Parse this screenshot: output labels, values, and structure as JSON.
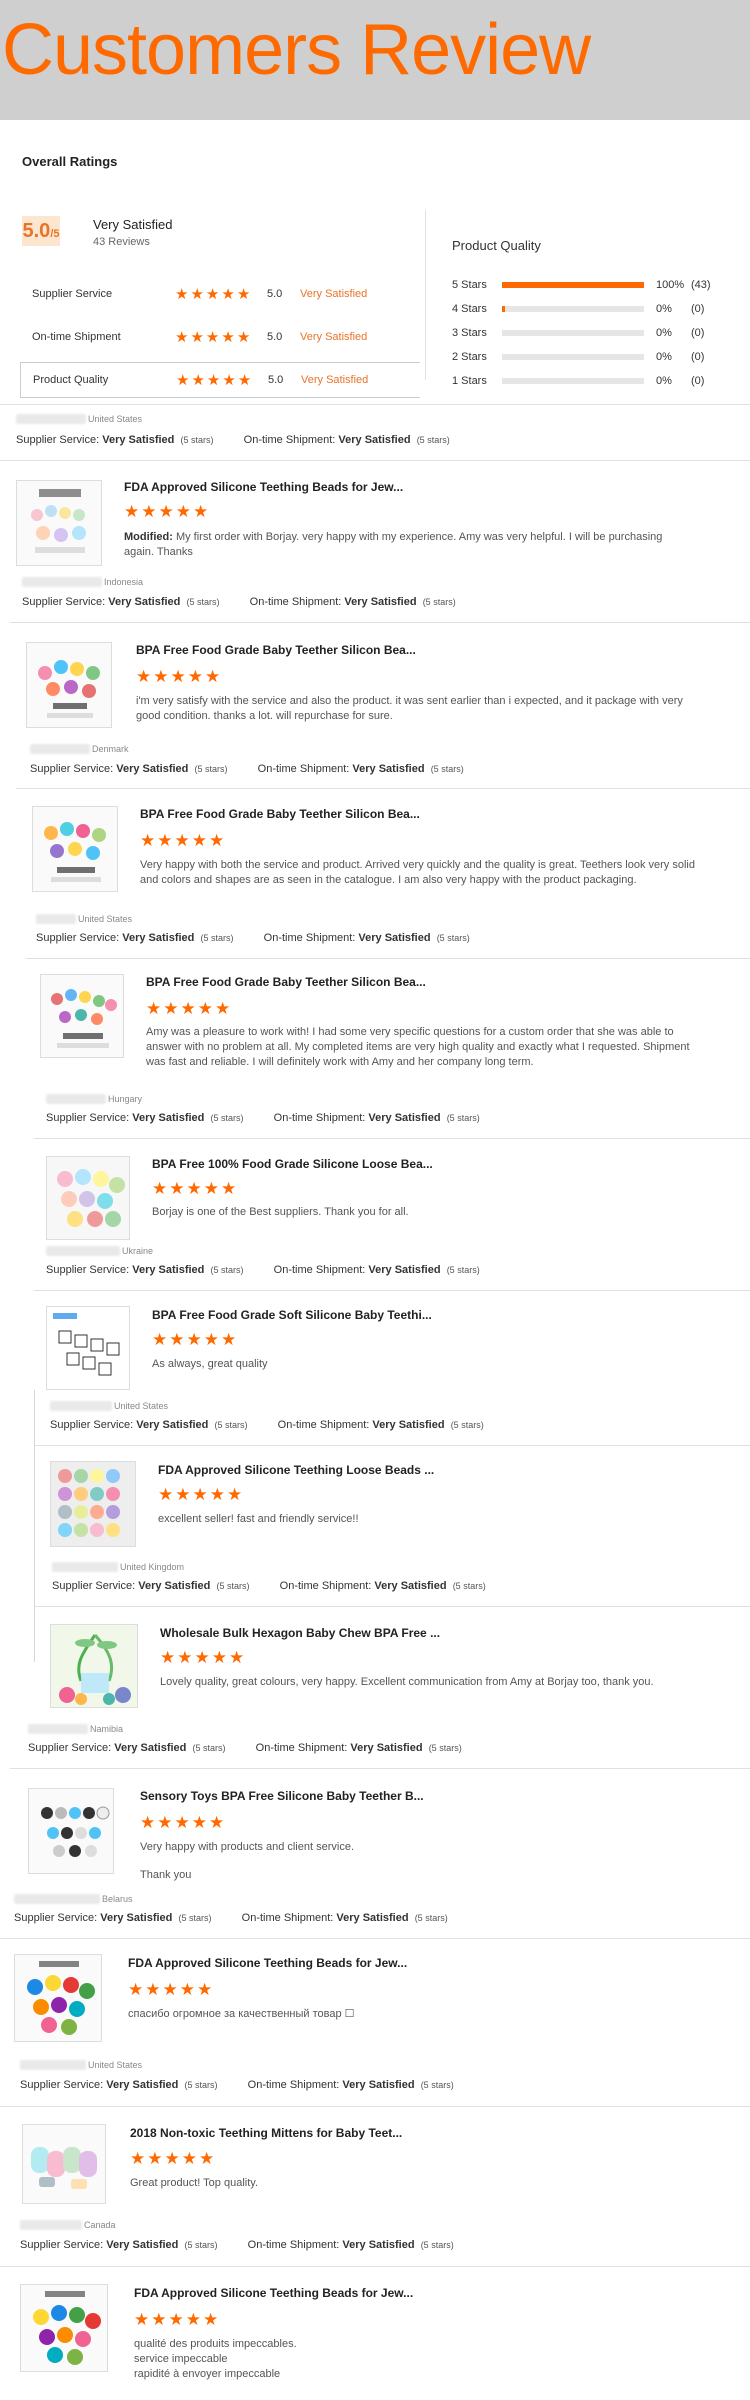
{
  "banner": {
    "title": "Customers Review"
  },
  "overall": {
    "title": "Overall Ratings",
    "score": "5.0",
    "score_denominator": "/5",
    "satisfaction": "Very Satisfied",
    "review_count": "43 Reviews",
    "rows": [
      {
        "label": "Supplier Service",
        "value": "5.0",
        "text": "Very Satisfied",
        "stars": 5
      },
      {
        "label": "On-time Shipment",
        "value": "5.0",
        "text": "Very Satisfied",
        "stars": 5
      },
      {
        "label": "Product Quality",
        "value": "5.0",
        "text": "Very Satisfied",
        "stars": 5
      }
    ]
  },
  "product_quality": {
    "title": "Product Quality",
    "distribution": [
      {
        "label": "5 Stars",
        "pct": "100%",
        "count": "(43)",
        "fraction": 1.0
      },
      {
        "label": "4 Stars",
        "pct": "0%",
        "count": "(0)",
        "fraction": 0.02
      },
      {
        "label": "3 Stars",
        "pct": "0%",
        "count": "(0)",
        "fraction": 0
      },
      {
        "label": "2 Stars",
        "pct": "0%",
        "count": "(0)",
        "fraction": 0
      },
      {
        "label": "1 Stars",
        "pct": "0%",
        "count": "(0)",
        "fraction": 0
      }
    ]
  },
  "labels": {
    "supplier_service": "Supplier Service:",
    "ontime_shipment": "On-time Shipment:",
    "very_satisfied": "Very Satisfied",
    "five_stars": "(5 stars)"
  },
  "reviews": [
    {
      "country": "United States"
    },
    {
      "country": "Indonesia",
      "title": "FDA Approved Silicone Teething Beads for Jew...",
      "modified": "Modified:",
      "text": "My first order with Borjay. very happy with my experience. Amy was very helpful. I will be purchasing again. Thanks"
    },
    {
      "country": "Denmark",
      "title": "BPA Free Food Grade Baby Teether Silicon Bea...",
      "text": "i'm very satisfy with the service and also the product. it was sent earlier than i expected, and it package with very good condition. thanks a lot. will repurchase for sure."
    },
    {
      "country": "United States",
      "title": "BPA Free Food Grade Baby Teether Silicon Bea...",
      "text": "Very happy with both the service and product. Arrived very quickly and the quality is great. Teethers look very solid and colors and shapes are as seen in the catalogue. I am also very happy with the product packaging."
    },
    {
      "country": "Hungary",
      "title": "BPA Free Food Grade Baby Teether Silicon Bea...",
      "text": "Amy was a pleasure to work with! I had some very specific questions for a custom order that she was able to answer with no problem at all. My completed items are very high quality and exactly what I requested. Shipment was fast and reliable. I will definitely work with Amy and her company long term."
    },
    {
      "country": "Ukraine",
      "title": "BPA Free 100% Food Grade Silicone Loose Bea...",
      "text": "Borjay is one of the Best suppliers. Thank you for all."
    },
    {
      "country": "United States",
      "title": "BPA Free Food Grade Soft Silicone Baby Teethi...",
      "text": "As always, great quality"
    },
    {
      "country": "United Kingdom",
      "title": "FDA Approved Silicone Teething Loose Beads ...",
      "text": "excellent seller! fast and friendly service!!"
    },
    {
      "country": "Namibia",
      "title": "Wholesale Bulk Hexagon Baby Chew BPA Free ...",
      "text": "Lovely quality, great colours, very happy. Excellent communication from Amy at Borjay too, thank you."
    },
    {
      "country": "Belarus",
      "title": "Sensory Toys BPA Free Silicone Baby Teether B...",
      "text": "Very happy with products and client service.",
      "text2": "Thank you"
    },
    {
      "country": "United States",
      "title": "FDA Approved Silicone Teething Beads for Jew...",
      "text": "спасибо огромное за качественный товар ☐"
    },
    {
      "country": "Canada",
      "title": "2018 Non-toxic Teething Mittens for Baby Teet...",
      "text": "Great product! Top quality."
    },
    {
      "title": "FDA Approved Silicone Teething Beads for Jew...",
      "text": "qualité des produits impeccables.",
      "text2": "service impeccable",
      "text3": "rapidité à envoyer impeccable"
    }
  ]
}
